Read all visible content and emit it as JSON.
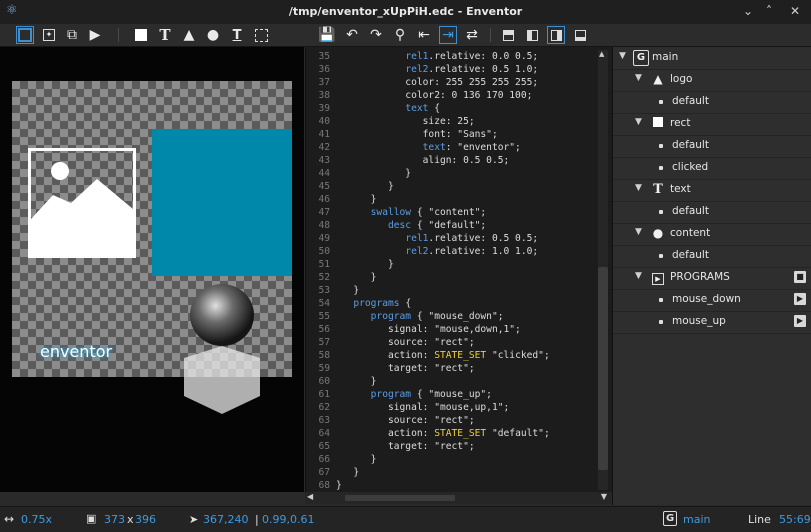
{
  "window": {
    "title": "/tmp/enventor_xUpPiH.edc - Enventor",
    "min": "⌄",
    "max": "˄",
    "close": "✕"
  },
  "preview": {
    "text": "enventor"
  },
  "code": [
    {
      "n": "35",
      "t": "            rel1.relative: 0.0 0.5;"
    },
    {
      "n": "36",
      "t": "            rel2.relative: 0.5 1.0;"
    },
    {
      "n": "37",
      "t": "            color: 255 255 255 255;"
    },
    {
      "n": "38",
      "t": "            color2: 0 136 170 100;"
    },
    {
      "n": "39",
      "t": "            text {"
    },
    {
      "n": "40",
      "t": "               size: 25;"
    },
    {
      "n": "41",
      "t": "               font: \"Sans\";"
    },
    {
      "n": "42",
      "t": "               text: \"enventor\";"
    },
    {
      "n": "43",
      "t": "               align: 0.5 0.5;"
    },
    {
      "n": "44",
      "t": "            }"
    },
    {
      "n": "45",
      "t": "         }"
    },
    {
      "n": "46",
      "t": "      }"
    },
    {
      "n": "47",
      "t": "      swallow { \"content\";"
    },
    {
      "n": "48",
      "t": "         desc { \"default\";"
    },
    {
      "n": "49",
      "t": "            rel1.relative: 0.5 0.5;"
    },
    {
      "n": "50",
      "t": "            rel2.relative: 1.0 1.0;"
    },
    {
      "n": "51",
      "t": "         }"
    },
    {
      "n": "52",
      "t": "      }"
    },
    {
      "n": "53",
      "t": "   }"
    },
    {
      "n": "54",
      "t": "   programs {"
    },
    {
      "n": "55",
      "t": "      program { \"mouse_down\";"
    },
    {
      "n": "56",
      "t": "         signal: \"mouse,down,1\";"
    },
    {
      "n": "57",
      "t": "         source: \"rect\";"
    },
    {
      "n": "58",
      "t": "         action: STATE_SET \"clicked\";"
    },
    {
      "n": "59",
      "t": "         target: \"rect\";"
    },
    {
      "n": "60",
      "t": "      }"
    },
    {
      "n": "61",
      "t": "      program { \"mouse_up\";"
    },
    {
      "n": "62",
      "t": "         signal: \"mouse,up,1\";"
    },
    {
      "n": "63",
      "t": "         source: \"rect\";"
    },
    {
      "n": "64",
      "t": "         action: STATE_SET \"default\";"
    },
    {
      "n": "65",
      "t": "         target: \"rect\";"
    },
    {
      "n": "66",
      "t": "      }"
    },
    {
      "n": "67",
      "t": "   }"
    },
    {
      "n": "68",
      "t": "}"
    }
  ],
  "tree": {
    "group": "main",
    "items": [
      {
        "kind": "part",
        "icon": "image-icon",
        "label": "logo"
      },
      {
        "kind": "state",
        "label": "default"
      },
      {
        "kind": "part",
        "icon": "rect-icon",
        "label": "rect"
      },
      {
        "kind": "state",
        "label": "default"
      },
      {
        "kind": "state",
        "label": "clicked"
      },
      {
        "kind": "part",
        "icon": "text-icon",
        "label": "text"
      },
      {
        "kind": "state",
        "label": "default"
      },
      {
        "kind": "part",
        "icon": "swallow-icon",
        "label": "content"
      },
      {
        "kind": "state",
        "label": "default"
      },
      {
        "kind": "programs",
        "icon": "programs-icon",
        "label": "PROGRAMS"
      },
      {
        "kind": "program",
        "label": "mouse_down"
      },
      {
        "kind": "program",
        "label": "mouse_up"
      }
    ]
  },
  "status": {
    "zoom": "0.75x",
    "size_w": "373",
    "size_x": "x",
    "size_h": "396",
    "cursor": "367,240",
    "sep": "|",
    "rel": "0.99,0.61",
    "group": "main",
    "line_label": "Line",
    "line_value": "55:69"
  },
  "colors": {
    "accent": "#3d9be0",
    "keyword": "#5b9ee6",
    "state_set": "#f0d030",
    "preview_bg": "#0088aa"
  }
}
